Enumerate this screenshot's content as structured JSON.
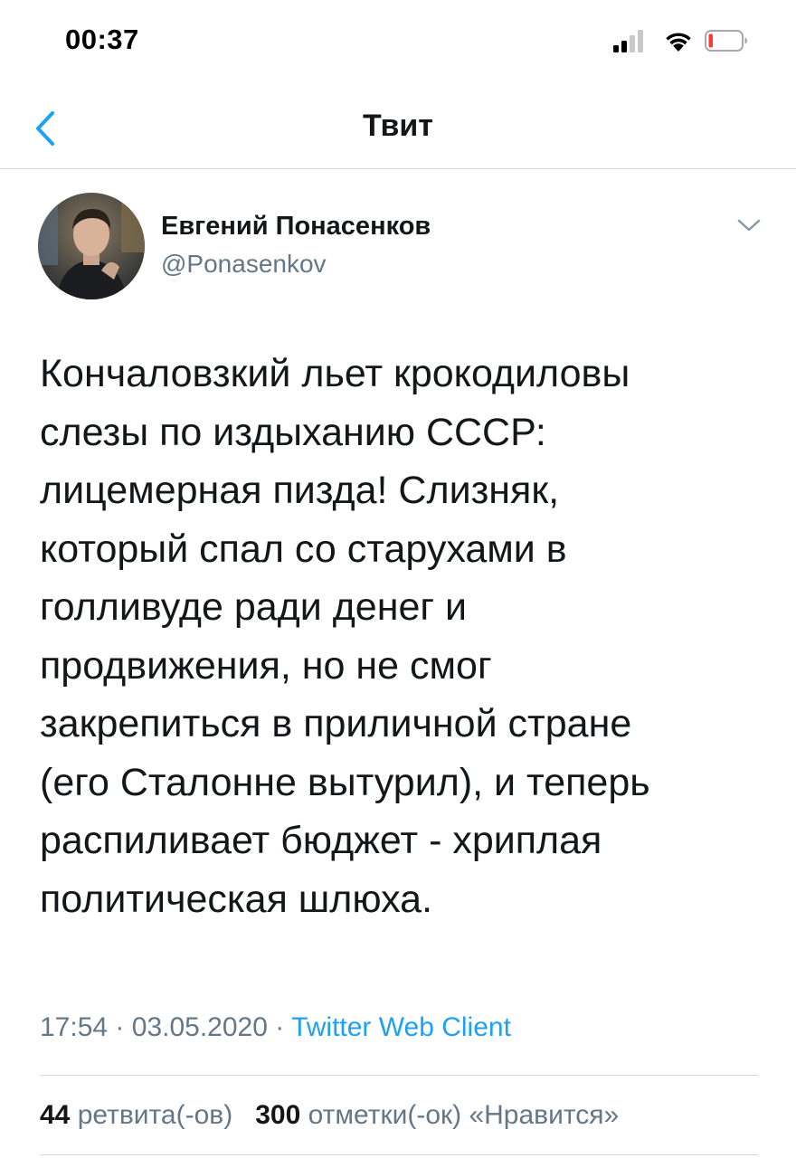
{
  "status_bar": {
    "time": "00:37"
  },
  "nav": {
    "title": "Твит"
  },
  "tweet": {
    "author_name": "Евгений Понасенков",
    "author_handle": "@Ponasenkov",
    "text_lines": [
      "Кончаловзкий льет крокодиловы",
      "слезы по издыханию СССР:",
      "лицемерная пизда! Слизняк,",
      "который спал со старухами в",
      "голливуде ради денег и",
      "продвижения, но не смог",
      "закрепиться в приличной стране",
      "(его Сталонне вытурил), и теперь",
      "распиливает бюджет - хриплая",
      "политическая шлюха."
    ],
    "time": "17:54",
    "separator": "·",
    "date": "03.05.2020",
    "source": "Twitter Web Client",
    "retweets_count": "44",
    "retweets_label": "ретвита(-ов)",
    "likes_count": "300",
    "likes_label": "отметки(-ок) «Нравится»"
  },
  "icons": {
    "back": "chevron-left-icon",
    "more": "chevron-down-icon",
    "signal": "cellular-signal-icon",
    "wifi": "wifi-icon",
    "battery": "battery-low-icon"
  },
  "colors": {
    "accent": "#1da1f2",
    "text_primary": "#14171a",
    "text_secondary": "#657786",
    "divider": "#d4d8dc",
    "battery_low": "#ff3b30"
  }
}
